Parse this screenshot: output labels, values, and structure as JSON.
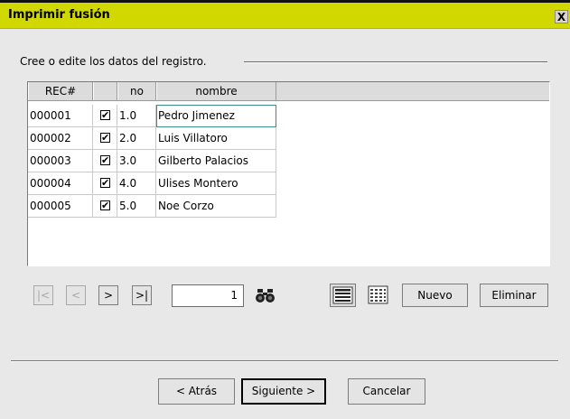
{
  "window": {
    "title": "Imprimir fusión",
    "close_label": "X"
  },
  "section": {
    "label": "Cree o edite los datos del registro."
  },
  "grid": {
    "headers": [
      "REC#",
      "",
      "no",
      "nombre"
    ],
    "rows": [
      {
        "rec": "000001",
        "checked": "✔",
        "no": "1.0",
        "nombre": "Pedro Jimenez"
      },
      {
        "rec": "000002",
        "checked": "✔",
        "no": "2.0",
        "nombre": "Luis Villatoro"
      },
      {
        "rec": "000003",
        "checked": "✔",
        "no": "3.0",
        "nombre": "Gilberto Palacios"
      },
      {
        "rec": "000004",
        "checked": "✔",
        "no": "4.0",
        "nombre": "Ulises Montero"
      },
      {
        "rec": "000005",
        "checked": "✔",
        "no": "5.0",
        "nombre": "Noe Corzo"
      }
    ]
  },
  "nav": {
    "first": "|<",
    "prev": "<",
    "next": ">",
    "last": ">|",
    "page": "1"
  },
  "icons": {
    "find": "binoculars-icon",
    "list_view": "list-view-icon",
    "grid_view": "grid-view-icon"
  },
  "actions": {
    "new": "Nuevo",
    "delete": "Eliminar"
  },
  "footer": {
    "back": "< Atrás",
    "next": "Siguiente >",
    "cancel": "Cancelar"
  },
  "colors": {
    "titlebar": "#d0d800",
    "dialog_bg": "#e8e8e8",
    "selection_outline": "#3c8c8c"
  }
}
